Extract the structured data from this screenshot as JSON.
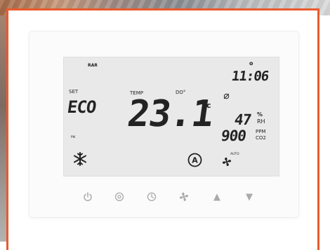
{
  "scene": {
    "accent_color": "#ea5a2d",
    "lcd_background": "#e9e9e9"
  },
  "lcd": {
    "top_left_small": "RAR",
    "set_label": "SET",
    "mode_text": "ECO",
    "mini_indicator": "PW",
    "temp_label": "TEMP",
    "temp_unit_indicator": "DO°",
    "temperature": "23.1",
    "temp_unit": "c",
    "time": "11:06",
    "time_dot": "o",
    "humidity_value": "47",
    "humidity_percent": "%",
    "humidity_label": "RH",
    "co2_value": "900",
    "co2_unit": "PPM",
    "co2_label": "CO2",
    "fan_label": "AUTO",
    "icons": [
      "snowflake-icon",
      "auto-mode-icon",
      "fan-icon",
      "lock-slash-icon"
    ]
  },
  "buttons": [
    {
      "name": "power-button",
      "icon": "power-icon"
    },
    {
      "name": "mode-button",
      "icon": "mode-icon"
    },
    {
      "name": "clock-button",
      "icon": "clock-icon"
    },
    {
      "name": "fan-button",
      "icon": "fan-icon"
    },
    {
      "name": "up-button",
      "icon": "up-arrow-icon",
      "glyph": "▲"
    },
    {
      "name": "down-button",
      "icon": "down-arrow-icon",
      "glyph": "▼"
    }
  ]
}
